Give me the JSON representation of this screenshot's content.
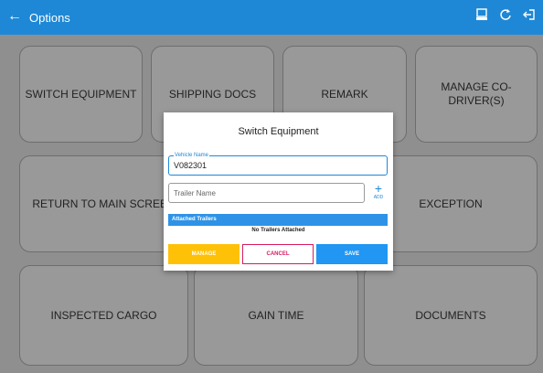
{
  "appbar": {
    "title": "Options"
  },
  "tiles": [
    {
      "label": "SWITCH EQUIPMENT"
    },
    {
      "label": "SHIPPING DOCS"
    },
    {
      "label": "REMARK"
    },
    {
      "label": "MANAGE CO-DRIVER(S)"
    },
    {
      "label": "RETURN TO MAIN SCREEN"
    },
    {
      "label": "EXCEPTION"
    },
    {
      "label": "INSPECTED CARGO"
    },
    {
      "label": "GAIN TIME"
    },
    {
      "label": "DOCUMENTS"
    }
  ],
  "dialog": {
    "title": "Switch Equipment",
    "vehicle_label": "Vehicle Name",
    "vehicle_value": "V082301",
    "trailer_placeholder": "Trailer Name",
    "add_label": "ADD",
    "attached_header": "Attached Trailers",
    "no_trailers": "No Trailers Attached",
    "buttons": {
      "manage": "MANAGE",
      "cancel": "CANCEL",
      "save": "SAVE"
    }
  },
  "colors": {
    "primary": "#1e88d6",
    "manage": "#ffc107",
    "cancel": "#d81b60",
    "save": "#2196f3"
  }
}
